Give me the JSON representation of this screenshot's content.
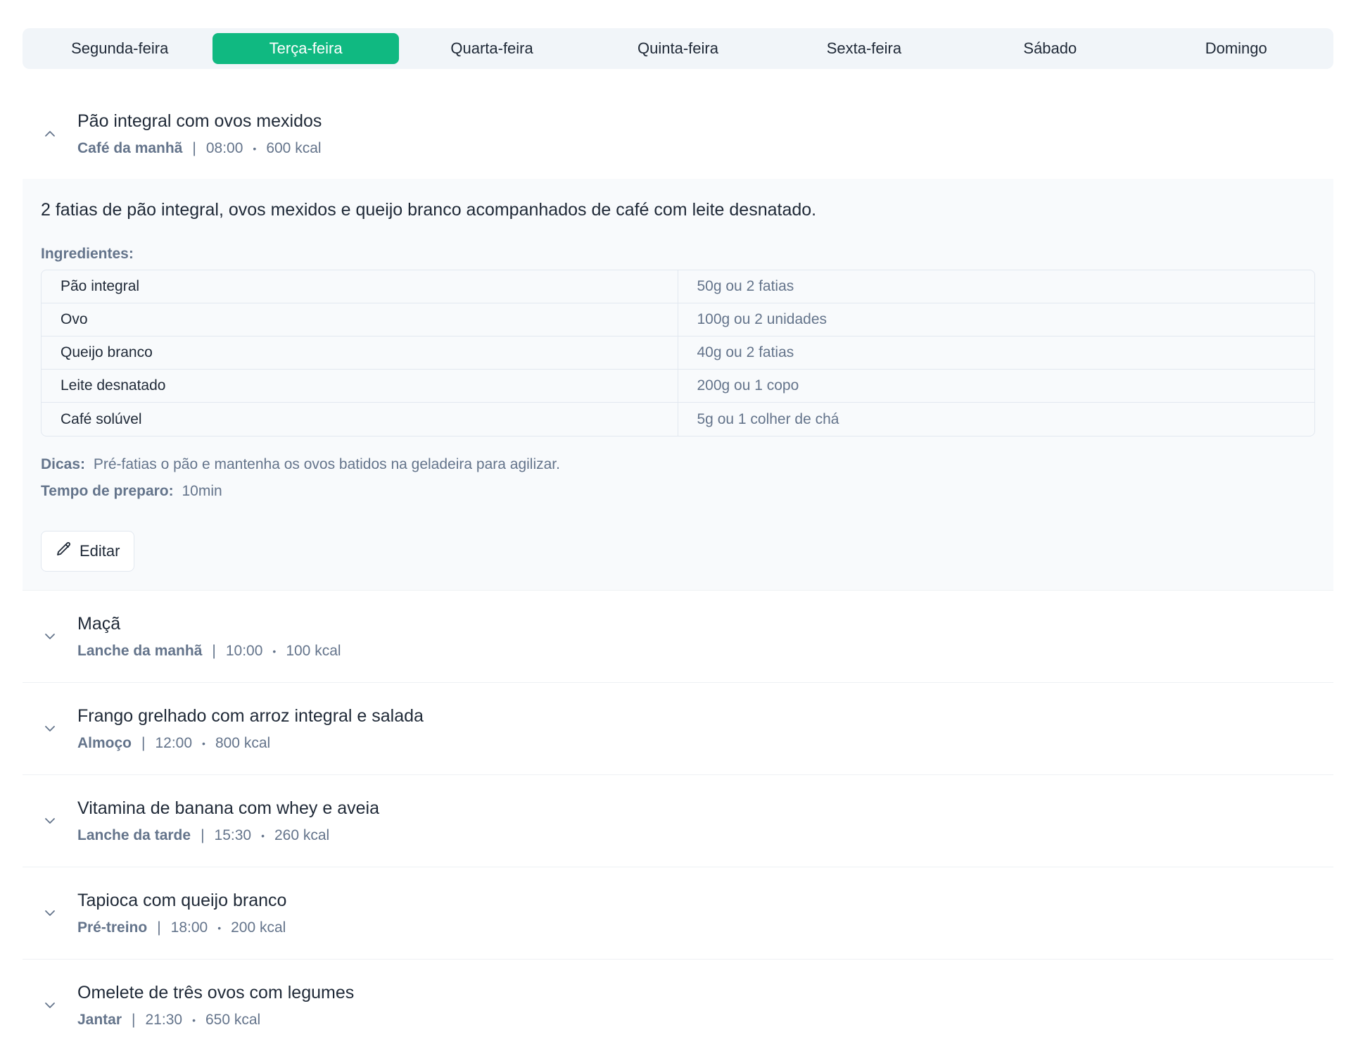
{
  "tabs": [
    {
      "label": "Segunda-feira",
      "active": false
    },
    {
      "label": "Terça-feira",
      "active": true
    },
    {
      "label": "Quarta-feira",
      "active": false
    },
    {
      "label": "Quinta-feira",
      "active": false
    },
    {
      "label": "Sexta-feira",
      "active": false
    },
    {
      "label": "Sábado",
      "active": false
    },
    {
      "label": "Domingo",
      "active": false
    }
  ],
  "colors": {
    "accent": "#10b981",
    "muted": "#64748b",
    "panel": "#f8fafc"
  },
  "meals": [
    {
      "title": "Pão integral com ovos mexidos",
      "type": "Café da manhã",
      "time": "08:00",
      "kcal": "600 kcal",
      "expanded": true,
      "icon": "chevron-up-icon"
    },
    {
      "title": "Maçã",
      "type": "Lanche da manhã",
      "time": "10:00",
      "kcal": "100 kcal",
      "expanded": false,
      "icon": "chevron-down-icon"
    },
    {
      "title": "Frango grelhado com arroz integral e salada",
      "type": "Almoço",
      "time": "12:00",
      "kcal": "800 kcal",
      "expanded": false,
      "icon": "chevron-down-icon"
    },
    {
      "title": "Vitamina de banana com whey e aveia",
      "type": "Lanche da tarde",
      "time": "15:30",
      "kcal": "260 kcal",
      "expanded": false,
      "icon": "chevron-down-icon"
    },
    {
      "title": "Tapioca com queijo branco",
      "type": "Pré-treino",
      "time": "18:00",
      "kcal": "200 kcal",
      "expanded": false,
      "icon": "chevron-down-icon"
    },
    {
      "title": "Omelete de três ovos com legumes",
      "type": "Jantar",
      "time": "21:30",
      "kcal": "650 kcal",
      "expanded": false,
      "icon": "chevron-down-icon"
    }
  ],
  "details": {
    "description": "2 fatias de pão integral, ovos mexidos e queijo branco acompanhados de café com leite desnatado.",
    "ingredients_label": "Ingredientes:",
    "ingredients": [
      {
        "name": "Pão integral",
        "qty": "50g ou 2 fatias"
      },
      {
        "name": "Ovo",
        "qty": "100g ou 2 unidades"
      },
      {
        "name": "Queijo branco",
        "qty": "40g ou 2 fatias"
      },
      {
        "name": "Leite desnatado",
        "qty": "200g ou 1 copo"
      },
      {
        "name": "Café solúvel",
        "qty": "5g ou 1 colher de chá"
      }
    ],
    "tips_label": "Dicas:",
    "tips": "Pré-fatias o pão e mantenha os ovos batidos na geladeira para agilizar.",
    "prep_label": "Tempo de preparo:",
    "prep": "10min",
    "edit_label": "Editar",
    "edit_icon": "pencil-icon"
  },
  "separators": {
    "bar": "|",
    "dot": "•"
  }
}
